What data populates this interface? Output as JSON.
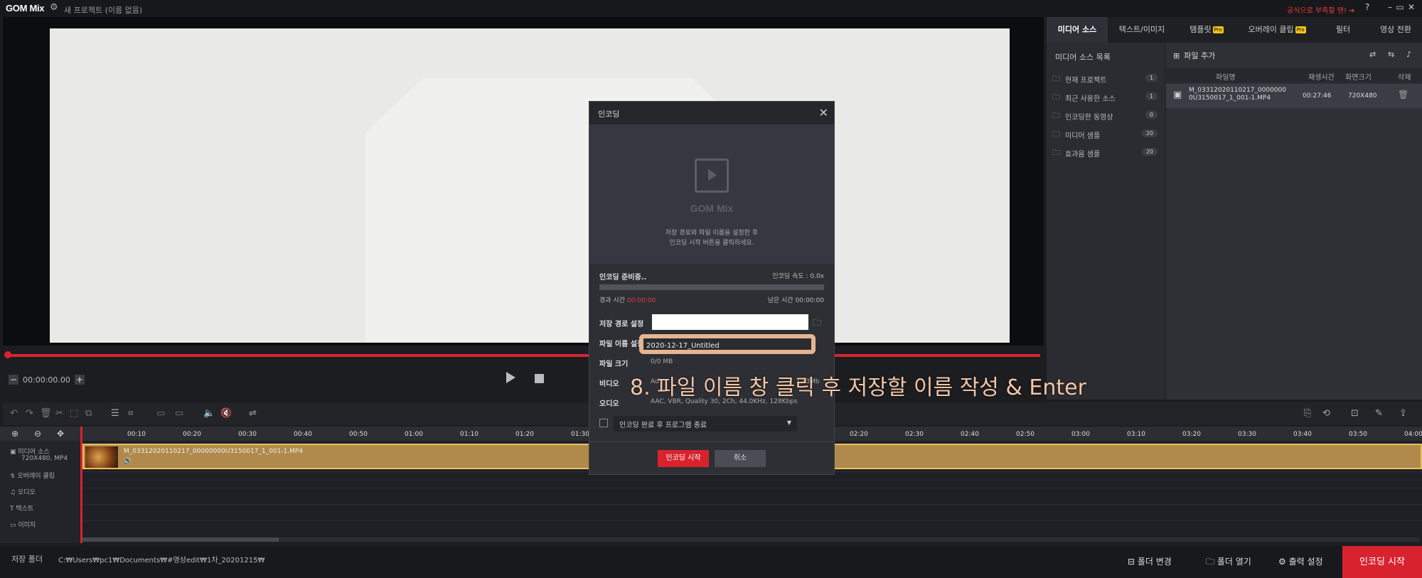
{
  "app": {
    "logo": "GOM Mix",
    "project_title": "새 프로젝트 (이름 없음)",
    "promo": "공식으로 부족할 땐! ➔",
    "help": "?",
    "win_min": "–",
    "win_restore": "▭",
    "win_close": "✕"
  },
  "preview": {
    "timecode": "00:00:00.00",
    "minus": "−",
    "plus": "+"
  },
  "right_panel": {
    "tabs": [
      {
        "label": "미디어 소스",
        "pro": ""
      },
      {
        "label": "텍스트/이미지",
        "pro": ""
      },
      {
        "label": "템플릿",
        "pro": "Pro"
      },
      {
        "label": "오버레이 클립",
        "pro": "Pro"
      },
      {
        "label": "필터",
        "pro": ""
      },
      {
        "label": "영상 전환",
        "pro": ""
      }
    ],
    "source_list_title": "미디어 소스 목록",
    "source_items": [
      {
        "label": "현재 프로젝트",
        "count": "1"
      },
      {
        "label": "최근 사용한 소스",
        "count": "1"
      },
      {
        "label": "인코딩한 동영상",
        "count": "0"
      },
      {
        "label": "미디어 샘플",
        "count": "20"
      },
      {
        "label": "효과음 샘플",
        "count": "20"
      }
    ],
    "add_file": "파일 추가",
    "file_columns": [
      "파일명",
      "재생시간",
      "화면크기",
      "삭제"
    ],
    "file_row": {
      "name": "M_03312020110217_00000000U3150017_1_001-1.MP4",
      "duration": "00:27:46",
      "size": "720X480"
    }
  },
  "timeline": {
    "ticks": [
      "00:10",
      "00:20",
      "00:30",
      "00:40",
      "00:50",
      "01:00",
      "01:10",
      "01:20",
      "01:30",
      "02:20",
      "02:30",
      "02:40",
      "02:50",
      "03:00",
      "03:10",
      "03:20",
      "03:30",
      "03:40",
      "03:50",
      "04:00"
    ],
    "track_labels": [
      "미디어 소스",
      "오버레이 클립",
      "오디오",
      "텍스트",
      "이미지"
    ],
    "media_meta": "720X480, MP4",
    "clip_name": "M_03312020110217_00000000U3150017_1_001-1.MP4"
  },
  "statusbar": {
    "save_folder_label": "저장 폴더",
    "save_folder_path": "C:₩Users₩pc1₩Documents₩#영상edit₩1차_20201215₩",
    "change_folder": "폴더 변경",
    "open_folder": "폴더 열기",
    "output_settings": "출력 설정",
    "encode_start": "인코딩 시작"
  },
  "modal": {
    "title": "인코딩",
    "close": "✕",
    "logo_text": "GOM Mix",
    "hint_line1": "저장 경로와 파일 이름을 설정한 후",
    "hint_line2": "인코딩 시작 버튼을 클릭하세요.",
    "status": "인코딩 준비중..",
    "speed": "인코딩 속도 : 0.0x",
    "progress": 0,
    "elapsed_label": "경과 시간",
    "elapsed_value": "00:00:00",
    "remaining_label": "남은 시간",
    "remaining_value": "00:00:00",
    "path_label": "저장 경로 설정",
    "filename_label": "파일 이름 설정",
    "filename_value": "2020-12-17_Untitled",
    "filesize_label": "파일 크기",
    "filesize_value": "0/0 MB",
    "video_label": "비디오",
    "video_value": "Ad",
    "video_tail": "7.43Mb",
    "audio_label": "오디오",
    "audio_value": "AAC, VBR, Quality 30, 2Ch, 44.0KHz, 128Kbps",
    "after_encode": "인코딩 완료 후 프로그램 종료",
    "start": "인코딩 시작",
    "cancel": "취소"
  },
  "overlay_caption": "8. 파일 이름 창 클릭 후 저장할 이름 작성 & Enter"
}
